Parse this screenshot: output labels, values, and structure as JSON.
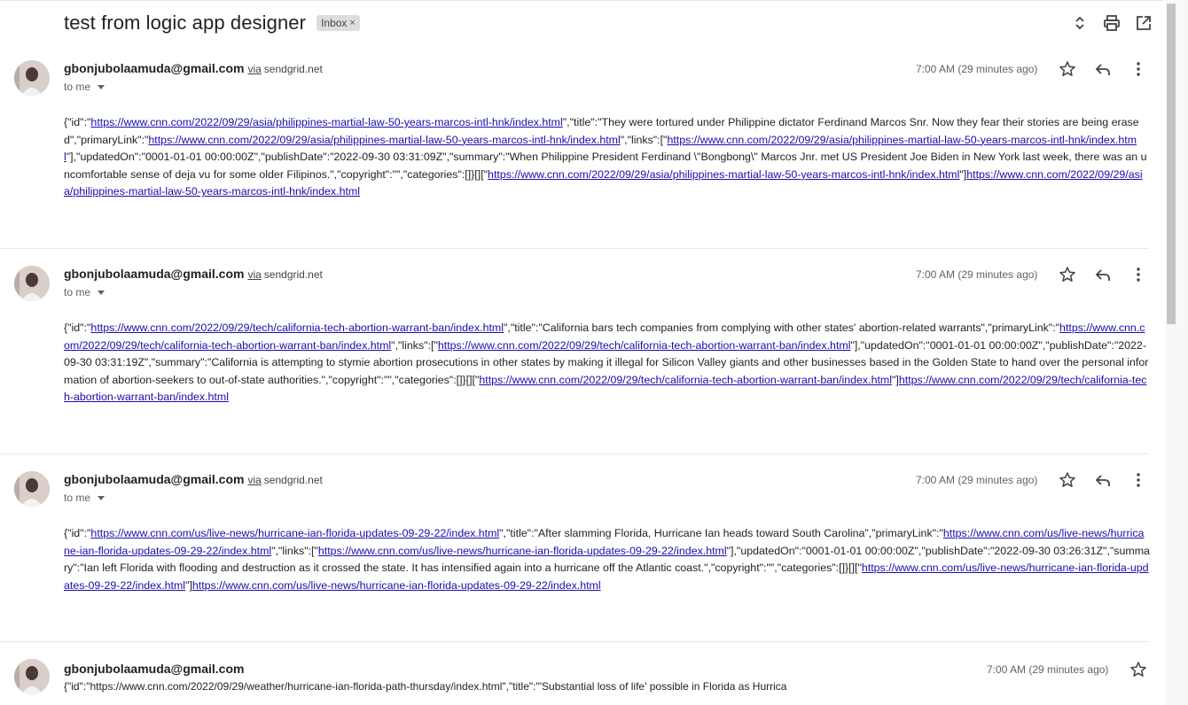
{
  "thread": {
    "subject": "test from logic app designer",
    "label": "Inbox",
    "label_remove": "×"
  },
  "toolbar_icons": [
    "expand-collapse-icon",
    "print-icon",
    "open-in-new-window-icon"
  ],
  "messages": [
    {
      "sender": "gbonjubolaamuda@gmail.com",
      "via": "via",
      "via_domain": "sendgrid.net",
      "to": "to me",
      "time": "7:00 AM (29 minutes ago)",
      "body": [
        {
          "t": "{\"id\":\""
        },
        {
          "l": "https://www.cnn.com/2022/09/29/asia/philippines-martial-law-50-years-marcos-intl-hnk/index.html"
        },
        {
          "t": "\",\"title\":\"They were tortured under Philippine dictator Ferdinand Marcos Snr. Now they fear their stories are being erased\",\"primaryLink\":\""
        },
        {
          "l": "https://www.cnn.com/2022/09/29/asia/philippines-martial-law-50-years-marcos-intl-hnk/index.html"
        },
        {
          "t": "\",\"links\":[\""
        },
        {
          "l": "https://www.cnn.com/2022/09/29/asia/philippines-martial-law-50-years-marcos-intl-hnk/index.html"
        },
        {
          "t": "\"],\"updatedOn\":\"0001-01-01 00:00:00Z\",\"publishDate\":\"2022-09-30 03:31:09Z\",\"summary\":\"When Philippine President Ferdinand \\\"Bongbong\\\" Marcos Jnr. met US President Joe Biden in New York last week, there was an uncomfortable sense of deja vu for some older Filipinos.\",\"copyright\":\"\",\"categories\":[]}[][\""
        },
        {
          "l": "https://www.cnn.com/2022/09/29/asia/philippines-martial-law-50-years-marcos-intl-hnk/index.html"
        },
        {
          "t": "\"]"
        },
        {
          "l": "https://www.cnn.com/2022/09/29/asia/philippines-martial-law-50-years-marcos-intl-hnk/index.html"
        }
      ]
    },
    {
      "sender": "gbonjubolaamuda@gmail.com",
      "via": "via",
      "via_domain": "sendgrid.net",
      "to": "to me",
      "time": "7:00 AM (29 minutes ago)",
      "body": [
        {
          "t": "{\"id\":\""
        },
        {
          "l": "https://www.cnn.com/2022/09/29/tech/california-tech-abortion-warrant-ban/index.html"
        },
        {
          "t": "\",\"title\":\"California bars tech companies from complying with other states' abortion-related warrants\",\"primaryLink\":\""
        },
        {
          "l": "https://www.cnn.com/2022/09/29/tech/california-tech-abortion-warrant-ban/index.html"
        },
        {
          "t": "\",\"links\":[\""
        },
        {
          "l": "https://www.cnn.com/2022/09/29/tech/california-tech-abortion-warrant-ban/index.html"
        },
        {
          "t": "\"],\"updatedOn\":\"0001-01-01 00:00:00Z\",\"publishDate\":\"2022-09-30 03:31:19Z\",\"summary\":\"California is attempting to stymie abortion prosecutions in other states by making it illegal for Silicon Valley giants and other businesses based in the Golden State to hand over the personal information of abortion-seekers to out-of-state authorities.\",\"copyright\":\"\",\"categories\":[]}[][\""
        },
        {
          "l": "https://www.cnn.com/2022/09/29/tech/california-tech-abortion-warrant-ban/index.html"
        },
        {
          "t": "\"]"
        },
        {
          "l": "https://www.cnn.com/2022/09/29/tech/california-tech-abortion-warrant-ban/index.html"
        }
      ]
    },
    {
      "sender": "gbonjubolaamuda@gmail.com",
      "via": "via",
      "via_domain": "sendgrid.net",
      "to": "to me",
      "time": "7:00 AM (29 minutes ago)",
      "body": [
        {
          "t": "{\"id\":\""
        },
        {
          "l": "https://www.cnn.com/us/live-news/hurricane-ian-florida-updates-09-29-22/index.html"
        },
        {
          "t": "\",\"title\":\"After slamming Florida, Hurricane Ian heads toward South Carolina\",\"primaryLink\":\""
        },
        {
          "l": "https://www.cnn.com/us/live-news/hurricane-ian-florida-updates-09-29-22/index.html"
        },
        {
          "t": "\",\"links\":[\""
        },
        {
          "l": "https://www.cnn.com/us/live-news/hurricane-ian-florida-updates-09-29-22/index.html"
        },
        {
          "t": "\"],\"updatedOn\":\"0001-01-01 00:00:00Z\",\"publishDate\":\"2022-09-30 03:26:31Z\",\"summary\":\"Ian left Florida with flooding and destruction as it crossed the state. It has intensified again into a hurricane off the Atlantic coast.\",\"copyright\":\"\",\"categories\":[]}[][\""
        },
        {
          "l": "https://www.cnn.com/us/live-news/hurricane-ian-florida-updates-09-29-22/index.html"
        },
        {
          "t": "\"]"
        },
        {
          "l": "https://www.cnn.com/us/live-news/hurricane-ian-florida-updates-09-29-22/index.html"
        }
      ]
    }
  ],
  "collapsed_message": {
    "sender": "gbonjubolaamuda@gmail.com",
    "time": "7:00 AM (29 minutes ago)",
    "snippet": "{\"id\":\"https://www.cnn.com/2022/09/29/weather/hurricane-ian-florida-path-thursday/index.html\",\"title\":\"'Substantial loss of life' possible in Florida as Hurrica"
  }
}
